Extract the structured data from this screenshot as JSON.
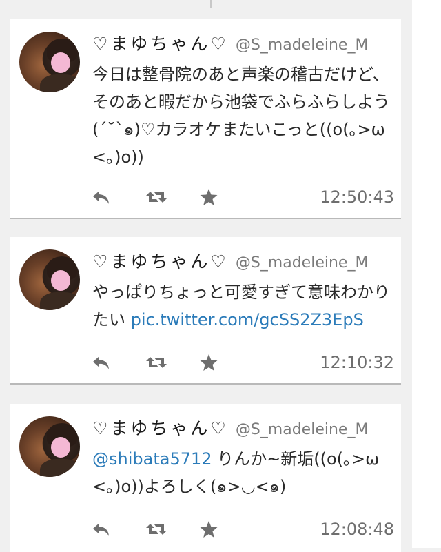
{
  "colors": {
    "background": "#f0f0f0",
    "card": "#ffffff",
    "link": "#2b7bb9",
    "icon": "#6e6e6e",
    "divider": "#b9b9b9"
  },
  "tweets": [
    {
      "name": "♡まゆちゃん♡",
      "handle": "@S_madeleine_M",
      "text": "今日は整骨院のあと声楽の稽古だけど、そのあと暇だから池袋でふらふらしよう(´˘`๑)♡カラオケまたいこっと((o(｡>ω<｡)o))",
      "time": "12:50:43",
      "icons": [
        "reply-icon",
        "retweet-icon",
        "favorite-star-icon"
      ]
    },
    {
      "name": "♡まゆちゃん♡",
      "handle": "@S_madeleine_M",
      "text": "やっぱりちょっと可愛すぎて意味わかりたい ",
      "link": "pic.twitter.com/gcSS2Z3EpS",
      "time": "12:10:32",
      "icons": [
        "reply-icon",
        "retweet-icon",
        "favorite-star-icon"
      ]
    },
    {
      "name": "♡まゆちゃん♡",
      "handle": "@S_madeleine_M",
      "mention": "@shibata5712",
      "text": " りんか~新垢((o(｡>ω<｡)o))よろしく(๑>◡<๑)",
      "time": "12:08:48",
      "icons": [
        "reply-icon",
        "retweet-icon",
        "favorite-star-icon"
      ]
    }
  ]
}
